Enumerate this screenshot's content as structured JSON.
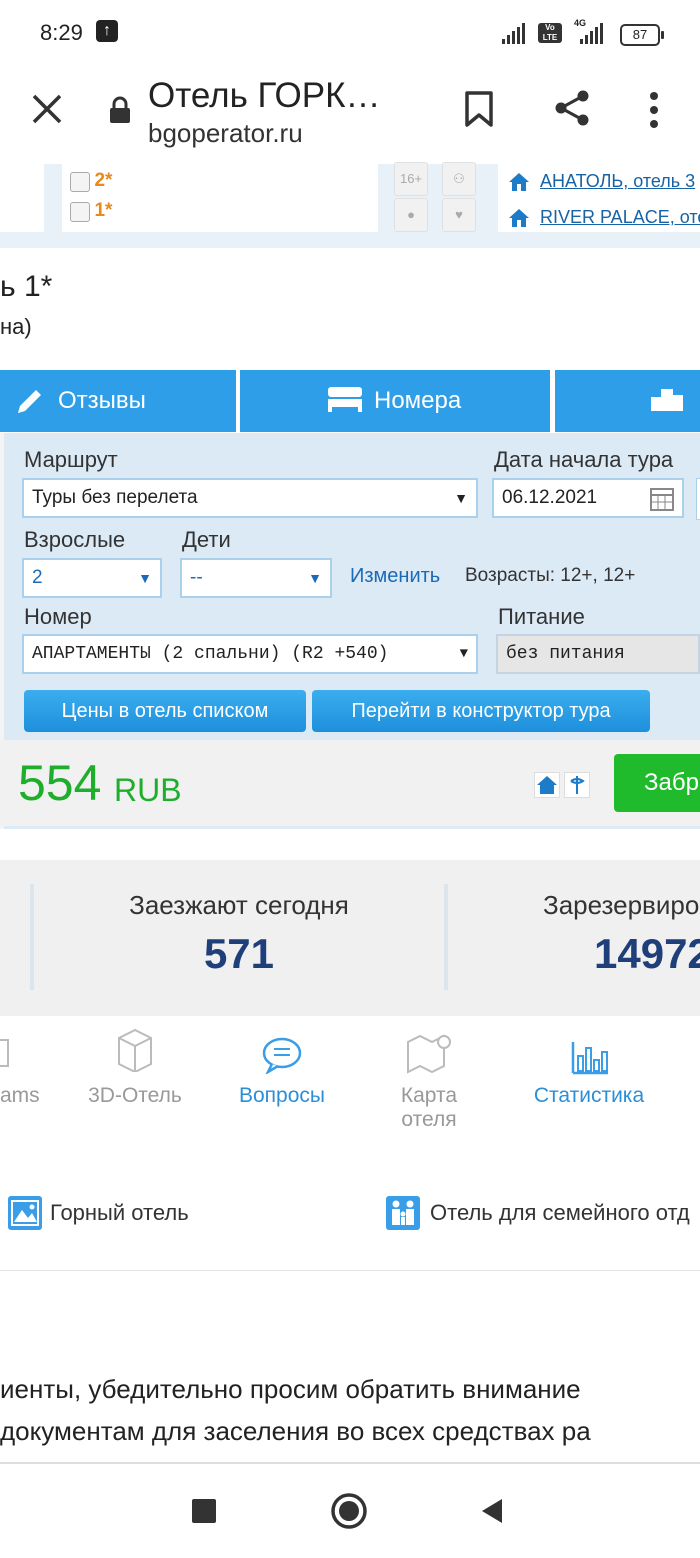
{
  "status_bar": {
    "time": "8:29",
    "battery": "87",
    "volte": "Vo LTE",
    "network": "4G"
  },
  "browser": {
    "title": "Отель ГОРК…",
    "url": "bgoperator.ru"
  },
  "filters": {
    "star2": "2*",
    "star1": "1*",
    "age_icon": "16+"
  },
  "hotel_links": [
    "АНАТОЛЬ, отель 3",
    "RIVER PALACE, оте"
  ],
  "hotel_heading": {
    "line1": "ь 1*",
    "line2": "на)"
  },
  "tabs": {
    "reviews": "Отзывы",
    "rooms": "Номера"
  },
  "form": {
    "route_label": "Маршрут",
    "route_value": "Туры без перелета",
    "date_label": "Дата начала тура",
    "date_value": "06.12.2021",
    "adults_label": "Взрослые",
    "adults_value": "2",
    "children_label": "Дети",
    "children_value": "--",
    "change_link": "Изменить",
    "ages_text": "Возрасты: 12+, 12+",
    "room_label": "Номер",
    "room_value": "АПАРТАМЕНТЫ (2 спальни) (R2 +540)",
    "meal_label": "Питание",
    "meal_value": "без питания",
    "btn_prices": "Цены в отель списком",
    "btn_constructor": "Перейти в конструктор тура"
  },
  "price": {
    "amount": "554",
    "currency": "RUB",
    "book_button": "Забр"
  },
  "stats": {
    "checkin_label": "Заезжают сегодня",
    "checkin_value": "571",
    "reserved_label": "Зарезервиро",
    "reserved_value": "14972"
  },
  "menu": {
    "item1": "ams",
    "item2": "3D-Отель",
    "item3": "Вопросы",
    "item4_line1": "Карта",
    "item4_line2": "отеля",
    "item5": "Статистика"
  },
  "tags": {
    "mountain": "Горный отель",
    "family": "Отель для семейного отд"
  },
  "notice": {
    "line1": "иенты, убедительно просим обратить внимание",
    "line2": "документам для заселения во всех средствах ра"
  },
  "colors": {
    "accent_blue": "#2e9ee8",
    "price_green": "#1fae2c",
    "stat_blue": "#1f3f7a"
  }
}
